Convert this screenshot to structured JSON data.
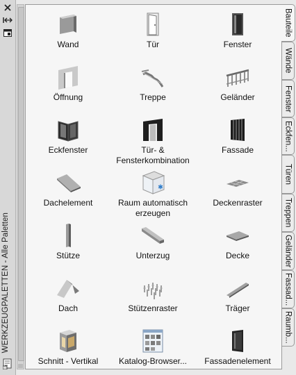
{
  "palette_title": "WERKZEUGPALETTEN - Alle Paletten",
  "tabs": [
    {
      "label": "Bauteile",
      "active": true
    },
    {
      "label": "Wände"
    },
    {
      "label": "Fenster"
    },
    {
      "label": "Eckfen..."
    },
    {
      "label": "Türen"
    },
    {
      "label": "Treppen"
    },
    {
      "label": "Geländer"
    },
    {
      "label": "Fassad..."
    },
    {
      "label": "Raumb..."
    }
  ],
  "tools": [
    {
      "label": "Wand",
      "icon": "wall-icon"
    },
    {
      "label": "Tür",
      "icon": "door-icon"
    },
    {
      "label": "Fenster",
      "icon": "window-icon"
    },
    {
      "label": "Öffnung",
      "icon": "opening-icon"
    },
    {
      "label": "Treppe",
      "icon": "stair-icon"
    },
    {
      "label": "Geländer",
      "icon": "railing-icon"
    },
    {
      "label": "Eckfenster",
      "icon": "corner-window-icon"
    },
    {
      "label": "Tür- & Fensterkombination",
      "icon": "door-window-assembly-icon"
    },
    {
      "label": "Fassade",
      "icon": "curtain-wall-icon"
    },
    {
      "label": "Dachelement",
      "icon": "roof-slab-icon"
    },
    {
      "label": "Raum automatisch erzeugen",
      "icon": "space-auto-generate-icon"
    },
    {
      "label": "Deckenraster",
      "icon": "ceiling-grid-icon"
    },
    {
      "label": "Stütze",
      "icon": "column-icon"
    },
    {
      "label": "Unterzug",
      "icon": "beam-icon"
    },
    {
      "label": "Decke",
      "icon": "slab-icon"
    },
    {
      "label": "Dach",
      "icon": "roof-icon"
    },
    {
      "label": "Stützenraster",
      "icon": "column-grid-icon"
    },
    {
      "label": "Träger",
      "icon": "brace-icon"
    },
    {
      "label": "Schnitt - Vertikal",
      "icon": "vertical-section-icon"
    },
    {
      "label": "Katalog-Browser...",
      "icon": "content-browser-icon"
    },
    {
      "label": "Fassadenelement",
      "icon": "curtain-wall-unit-icon"
    }
  ]
}
